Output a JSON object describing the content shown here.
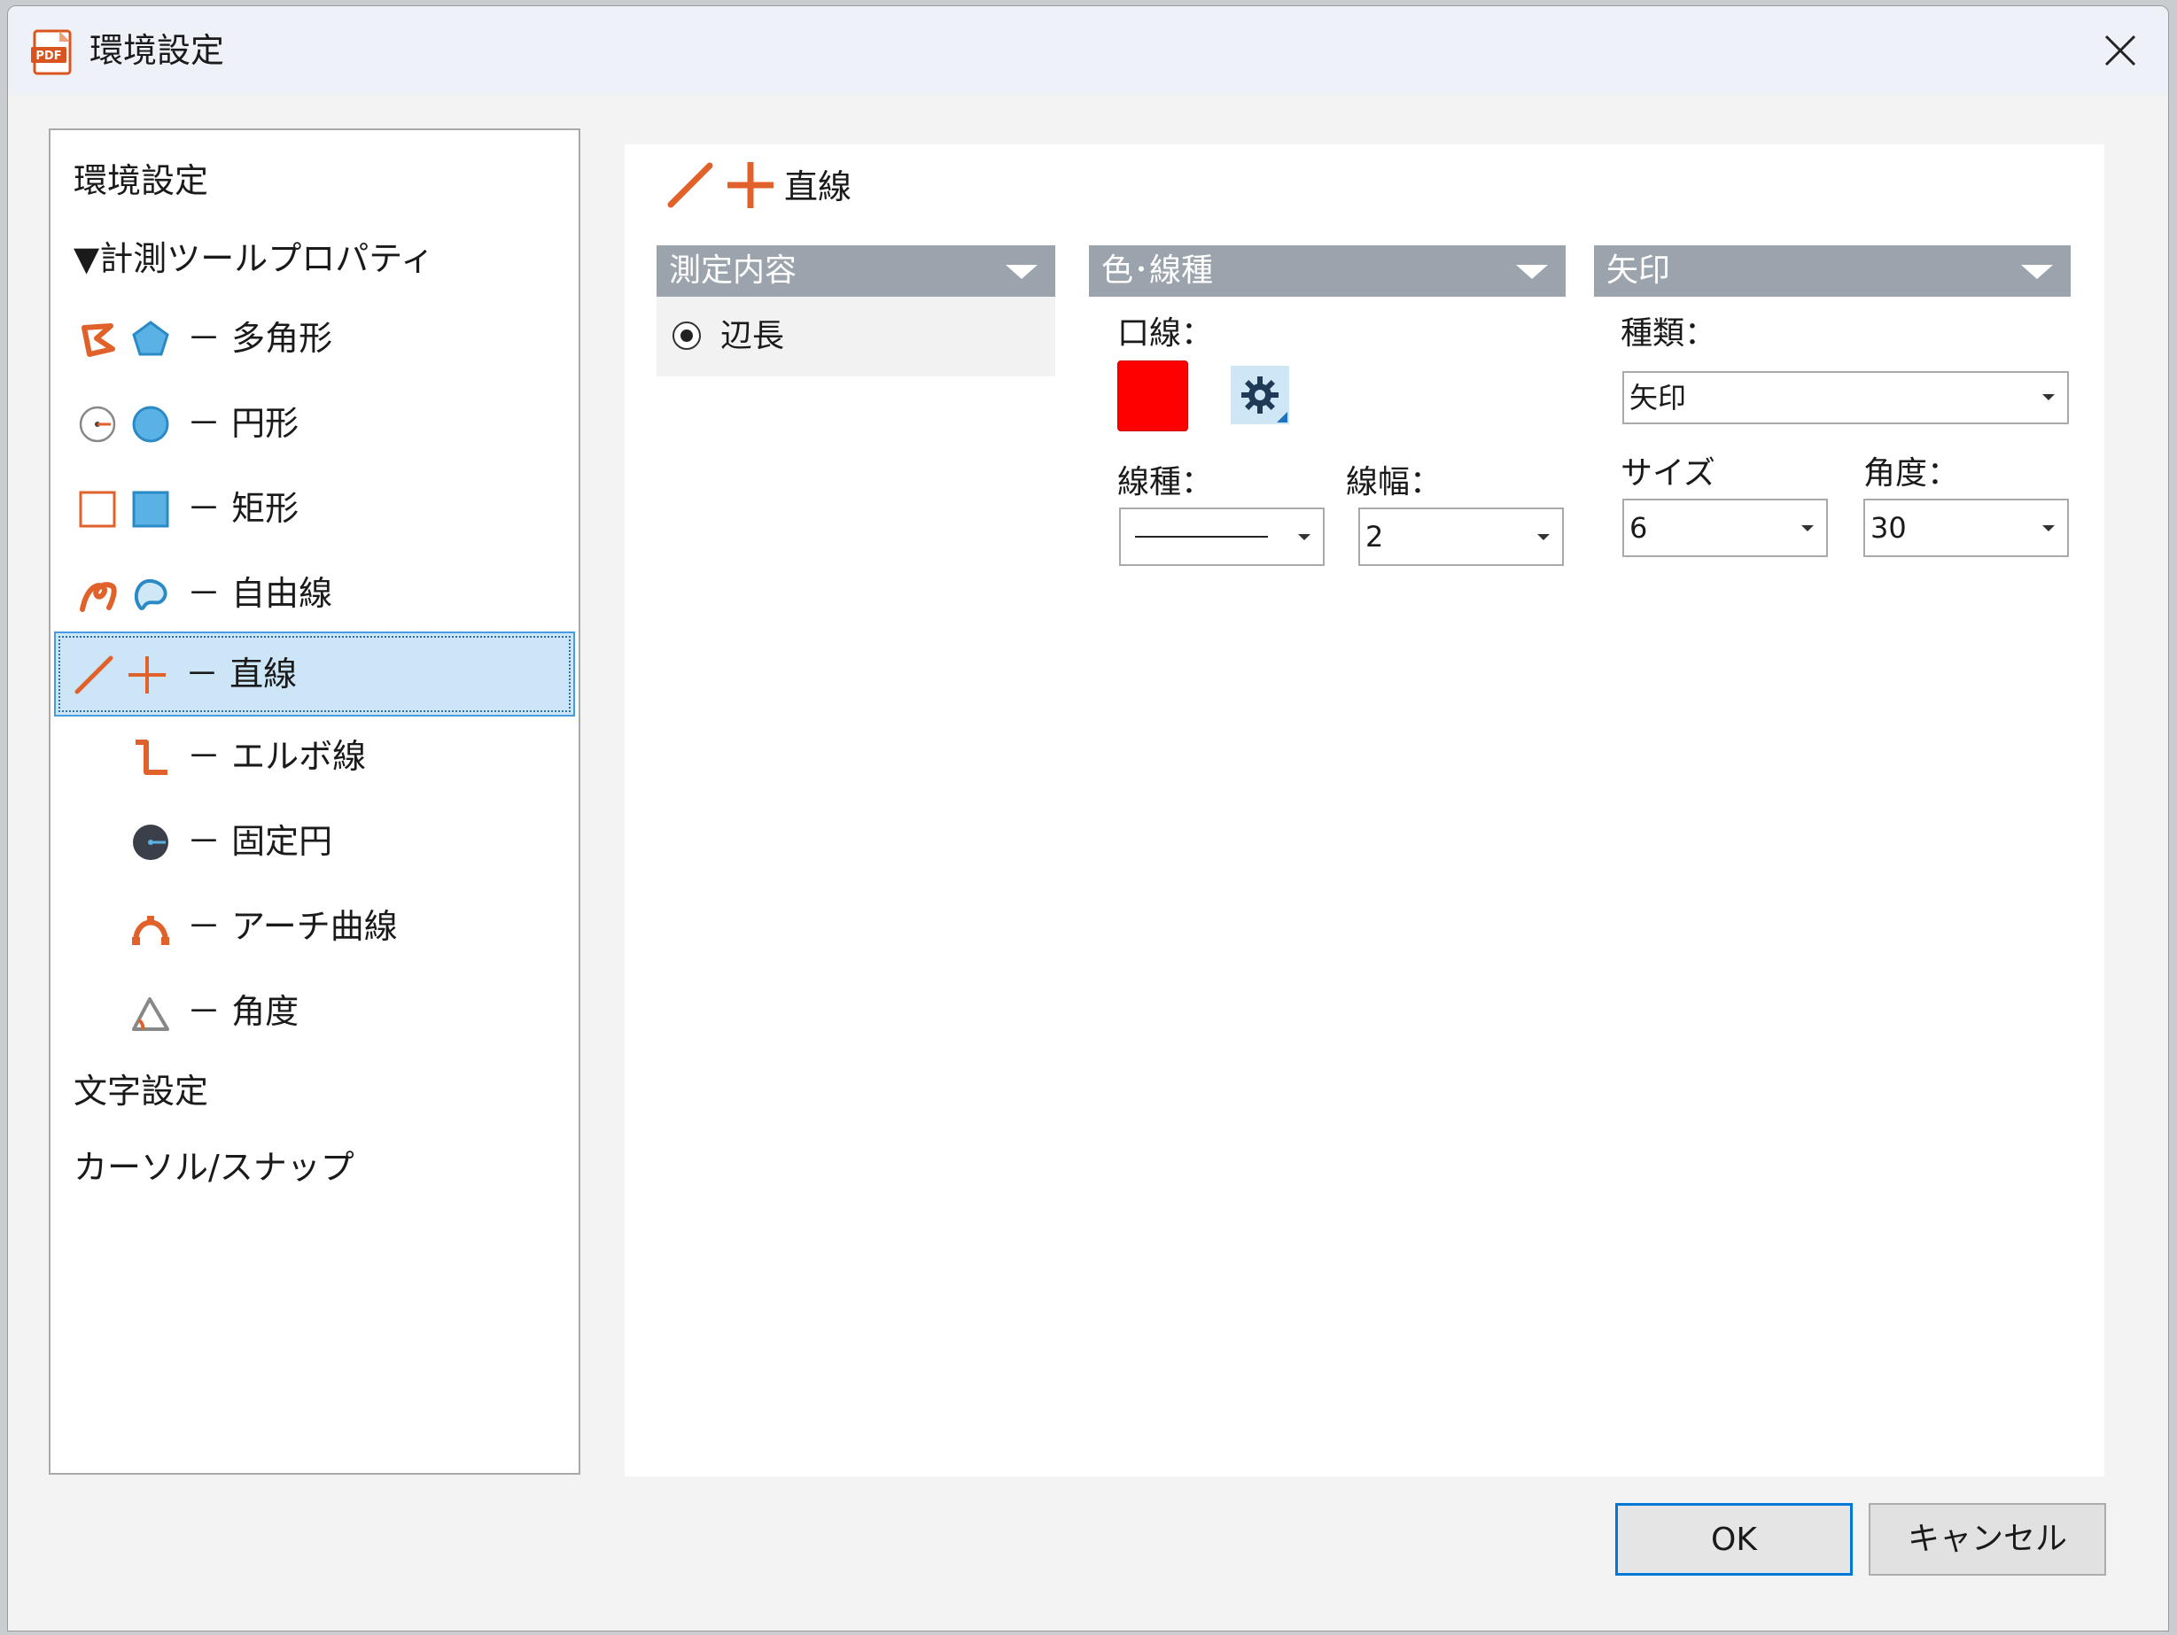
{
  "window": {
    "title": "環境設定",
    "app_icon": "pdf-app-icon",
    "close_icon": "close-icon"
  },
  "tree": {
    "items": [
      {
        "label": "環境設定"
      },
      {
        "label": "▼計測ツールプロパティ"
      },
      {
        "label": "－ 多角形",
        "icons": [
          "polygon-orange-icon",
          "polygon-blue-icon"
        ]
      },
      {
        "label": "－ 円形",
        "icons": [
          "circle-measure-icon",
          "circle-blue-icon"
        ]
      },
      {
        "label": "－ 矩形",
        "icons": [
          "rectangle-orange-icon",
          "rectangle-blue-icon"
        ]
      },
      {
        "label": "－ 自由線",
        "icons": [
          "freeline-orange-icon",
          "freeline-blue-icon"
        ]
      },
      {
        "label": "－ 直線",
        "icons": [
          "line-orange-icon",
          "cross-orange-icon"
        ],
        "selected": true
      },
      {
        "label": "－ エルボ線",
        "icons": [
          "elbow-line-icon"
        ]
      },
      {
        "label": "－ 固定円",
        "icons": [
          "fixed-circle-icon"
        ]
      },
      {
        "label": "－ アーチ曲線",
        "icons": [
          "arch-curve-icon"
        ]
      },
      {
        "label": "－ 角度",
        "icons": [
          "angle-icon"
        ]
      },
      {
        "label": "文字設定"
      },
      {
        "label": "カーソル/スナップ"
      }
    ]
  },
  "content": {
    "title": "直線",
    "sections": {
      "measure": {
        "header": "測定内容",
        "radio_label": "辺長",
        "radio_selected": true
      },
      "color": {
        "header": "色･線種",
        "line_color_label": "口線：",
        "line_color": "#ff0000",
        "settings_icon": "gear-icon",
        "line_type_label": "線種：",
        "line_type_value": "solid",
        "line_width_label": "線幅：",
        "line_width_value": "2"
      },
      "arrow": {
        "header": "矢印",
        "type_label": "種類：",
        "type_value": "矢印",
        "size_label": "サイズ",
        "size_value": "6",
        "angle_label": "角度：",
        "angle_value": "30"
      }
    }
  },
  "buttons": {
    "ok": "OK",
    "cancel": "キャンセル"
  },
  "colors": {
    "accent_orange": "#e0622a",
    "accent_blue": "#3a9bd5",
    "selection": "#cce6f7",
    "section_header": "#9ba4ad"
  }
}
